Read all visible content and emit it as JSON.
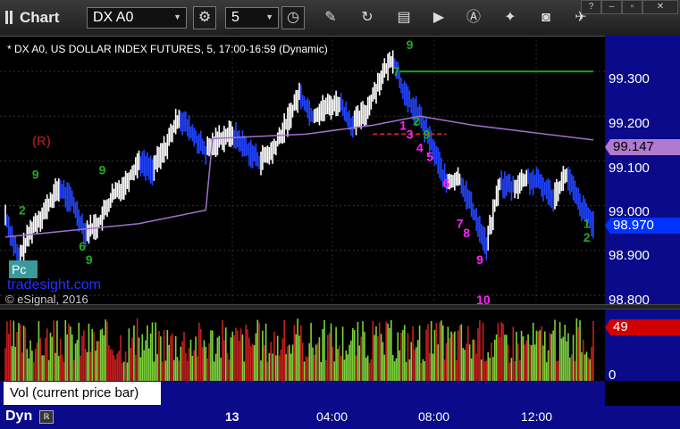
{
  "app": {
    "title": "Chart",
    "symbol": "DX A0",
    "interval": "5"
  },
  "chart_info": "* DX A0, US DOLLAR INDEX FUTURES, 5, 17:00-16:59 (Dynamic)",
  "annotations": {
    "r_label": "(R)",
    "watermark": "tradesight.com",
    "copyright": "© eSignal, 2016",
    "cursor_box": "Pc"
  },
  "legend": {
    "vol_label": "Vol (current price bar)",
    "close": "×"
  },
  "bottom": {
    "dyn": "Dyn",
    "dyn_icon": "ℝ"
  },
  "colors": {
    "background": "#000000",
    "axis_panel": "#0a0a8a",
    "avg_line": "#a070d0",
    "up_bar": "#ffffff",
    "down_bar": "#2244ff",
    "vol_up": "#7cd23c",
    "vol_down": "#c81e1e",
    "sequence_magenta": "#ff22ff",
    "sequence_green": "#22aa22",
    "resistance_green": "#1aa01a",
    "support_red": "#cc2222"
  },
  "icons": [
    "gear-icon",
    "clock-icon",
    "pencil-icon",
    "refresh-icon",
    "table-icon",
    "play-icon",
    "alert-icon",
    "tools-icon",
    "camera-icon",
    "twitter-icon"
  ],
  "chart_data": {
    "type": "line",
    "title": "DX A0, US DOLLAR INDEX FUTURES, 5, 17:00-16:59 (Dynamic)",
    "y_ticks": [
      "99.300",
      "99.200",
      "99.100",
      "99.000",
      "98.900",
      "98.800"
    ],
    "ylim": [
      98.78,
      99.38
    ],
    "x_ticks": [
      "13",
      "04:00",
      "08:00",
      "12:00"
    ],
    "last_price": "98.970",
    "avg_price": "99.147",
    "volume_last": "49",
    "volume_ticks": [
      "0"
    ],
    "price_series": [
      {
        "t": 0,
        "p": 98.98
      },
      {
        "t": 4,
        "p": 98.88
      },
      {
        "t": 8,
        "p": 98.95
      },
      {
        "t": 12,
        "p": 98.99
      },
      {
        "t": 16,
        "p": 99.04
      },
      {
        "t": 20,
        "p": 99.01
      },
      {
        "t": 24,
        "p": 98.94
      },
      {
        "t": 28,
        "p": 98.96
      },
      {
        "t": 32,
        "p": 99.02
      },
      {
        "t": 36,
        "p": 99.05
      },
      {
        "t": 40,
        "p": 99.1
      },
      {
        "t": 44,
        "p": 99.08
      },
      {
        "t": 48,
        "p": 99.13
      },
      {
        "t": 52,
        "p": 99.2
      },
      {
        "t": 56,
        "p": 99.16
      },
      {
        "t": 60,
        "p": 99.12
      },
      {
        "t": 64,
        "p": 99.15
      },
      {
        "t": 68,
        "p": 99.16
      },
      {
        "t": 72,
        "p": 99.13
      },
      {
        "t": 76,
        "p": 99.1
      },
      {
        "t": 80,
        "p": 99.12
      },
      {
        "t": 84,
        "p": 99.18
      },
      {
        "t": 88,
        "p": 99.25
      },
      {
        "t": 92,
        "p": 99.2
      },
      {
        "t": 96,
        "p": 99.22
      },
      {
        "t": 100,
        "p": 99.23
      },
      {
        "t": 104,
        "p": 99.18
      },
      {
        "t": 108,
        "p": 99.21
      },
      {
        "t": 112,
        "p": 99.28
      },
      {
        "t": 116,
        "p": 99.33
      },
      {
        "t": 120,
        "p": 99.24
      },
      {
        "t": 124,
        "p": 99.2
      },
      {
        "t": 128,
        "p": 99.13
      },
      {
        "t": 132,
        "p": 99.05
      },
      {
        "t": 136,
        "p": 99.06
      },
      {
        "t": 140,
        "p": 98.99
      },
      {
        "t": 144,
        "p": 98.91
      },
      {
        "t": 148,
        "p": 99.05
      },
      {
        "t": 152,
        "p": 99.04
      },
      {
        "t": 156,
        "p": 99.06
      },
      {
        "t": 160,
        "p": 99.05
      },
      {
        "t": 164,
        "p": 99.02
      },
      {
        "t": 168,
        "p": 99.07
      },
      {
        "t": 172,
        "p": 99.0
      },
      {
        "t": 176,
        "p": 98.96
      }
    ],
    "avg_series": [
      {
        "t": 0,
        "p": 98.93
      },
      {
        "t": 40,
        "p": 98.96
      },
      {
        "t": 60,
        "p": 98.99
      },
      {
        "t": 62,
        "p": 99.15
      },
      {
        "t": 90,
        "p": 99.16
      },
      {
        "t": 110,
        "p": 99.18
      },
      {
        "t": 124,
        "p": 99.2
      },
      {
        "t": 140,
        "p": 99.18
      },
      {
        "t": 176,
        "p": 99.147
      }
    ],
    "resistance_line": {
      "t_start": 118,
      "t_end": 176,
      "p": 99.3
    },
    "support_line": {
      "t_start": 110,
      "t_end": 132,
      "p": 99.16
    },
    "sequence_magenta": [
      {
        "label": "1",
        "t": 118,
        "p": 99.17
      },
      {
        "label": "3",
        "t": 120,
        "p": 99.15
      },
      {
        "label": "4",
        "t": 123,
        "p": 99.12
      },
      {
        "label": "5",
        "t": 126,
        "p": 99.1
      },
      {
        "label": "6",
        "t": 131,
        "p": 99.04
      },
      {
        "label": "7",
        "t": 135,
        "p": 98.95
      },
      {
        "label": "8",
        "t": 137,
        "p": 98.93
      },
      {
        "label": "9",
        "t": 141,
        "p": 98.87
      },
      {
        "label": "10",
        "t": 141,
        "p": 98.78
      }
    ],
    "sequence_green": [
      {
        "label": "9",
        "t": 120,
        "p": 99.35
      },
      {
        "label": "7",
        "t": 116,
        "p": 99.29
      },
      {
        "label": "9",
        "t": 8,
        "p": 99.06
      },
      {
        "label": "9",
        "t": 28,
        "p": 99.07
      },
      {
        "label": "9",
        "t": 24,
        "p": 98.87
      },
      {
        "label": "2",
        "t": 173,
        "p": 98.92
      },
      {
        "label": "1",
        "t": 173,
        "p": 98.95
      },
      {
        "label": "9",
        "t": 125,
        "p": 99.15
      },
      {
        "label": "2",
        "t": 122,
        "p": 99.18
      },
      {
        "label": "2",
        "t": 4,
        "p": 98.98
      },
      {
        "label": "6",
        "t": 22,
        "p": 98.9
      }
    ]
  }
}
